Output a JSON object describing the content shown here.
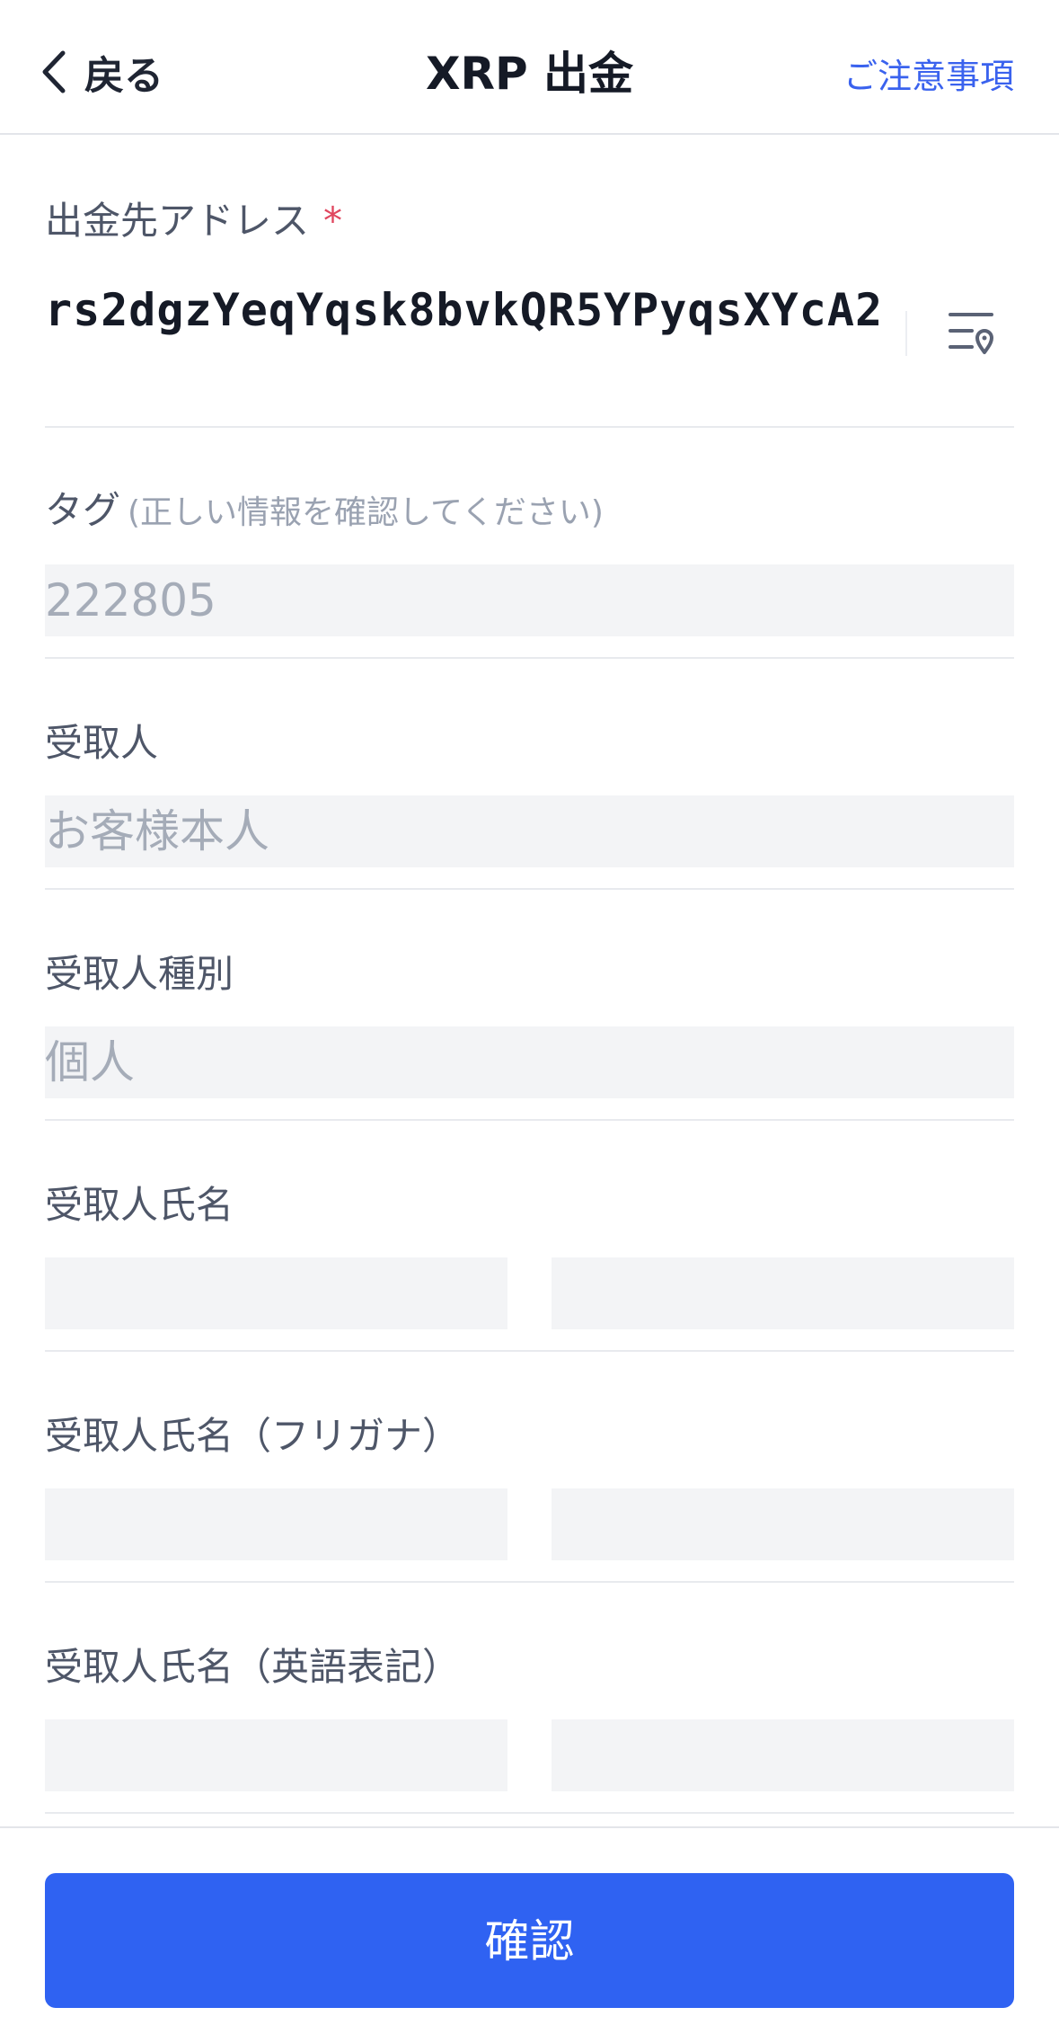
{
  "header": {
    "back_label": "戻る",
    "title": "XRP 出金",
    "notice_link": "ご注意事項"
  },
  "address_field": {
    "label": "出金先アドレス",
    "required_mark": "*",
    "value": "rs2dgzYeqYqsk8bvkQR5YPyqsXYcA2",
    "icon": "address-book-icon"
  },
  "tag_field": {
    "label": "タグ",
    "hint": "(正しい情報を確認してください)",
    "value": "222805"
  },
  "recipient_field": {
    "label": "受取人",
    "value": "お客様本人"
  },
  "recipient_type_field": {
    "label": "受取人種別",
    "value": "個人"
  },
  "recipient_name_field": {
    "label": "受取人氏名",
    "first_value": "",
    "second_value": ""
  },
  "recipient_furigana_field": {
    "label": "受取人氏名（フリガナ）",
    "first_value": "",
    "second_value": ""
  },
  "recipient_english_field": {
    "label": "受取人氏名（英語表記）",
    "first_value": "",
    "second_value": ""
  },
  "confirm_button": {
    "label": "確認"
  },
  "colors": {
    "accent": "#2f62f2",
    "link": "#3a62ee",
    "required": "#e0475f",
    "field_bg": "#f3f4f6"
  }
}
